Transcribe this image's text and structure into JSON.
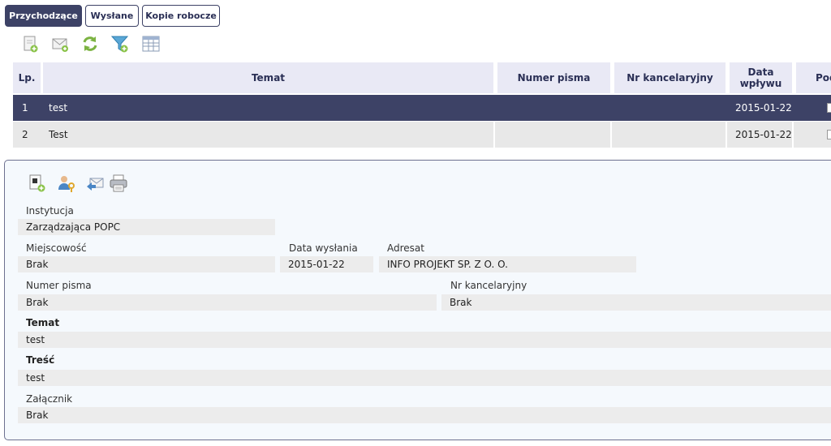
{
  "tabs": [
    {
      "label": "Przychodzące",
      "active": true
    },
    {
      "label": "Wysłane",
      "active": false
    },
    {
      "label": "Kopie robocze",
      "active": false
    }
  ],
  "toolbar": {
    "icons": [
      "new-document-icon",
      "mail-icon",
      "refresh-icon",
      "filter-add-icon",
      "table-columns-icon"
    ]
  },
  "table": {
    "headers": {
      "lp": "Lp.",
      "temat": "Temat",
      "numer_pisma": "Numer pisma",
      "nr_kancelaryjny": "Nr kancelaryjny",
      "data_wplywu": "Data wpływu",
      "pod": "Pod"
    },
    "rows": [
      {
        "lp": "1",
        "temat": "test",
        "numer_pisma": "",
        "nr_kancelaryjny": "",
        "data_wplywu": "2015-01-22"
      },
      {
        "lp": "2",
        "temat": "Test",
        "numer_pisma": "",
        "nr_kancelaryjny": "",
        "data_wplywu": "2015-01-22"
      }
    ]
  },
  "detail": {
    "icons": [
      "attach-add-icon",
      "user-key-icon",
      "reply-mail-icon",
      "printer-icon"
    ],
    "instytucja": {
      "label": "Instytucja",
      "value": "Zarządzająca POPC"
    },
    "miejscowosc": {
      "label": "Miejscowość",
      "value": "Brak"
    },
    "data_wyslania": {
      "label": "Data wysłania",
      "value": "2015-01-22"
    },
    "adresat": {
      "label": "Adresat",
      "value": "INFO PROJEKT SP. Z O. O."
    },
    "numer_pisma": {
      "label": "Numer pisma",
      "value": "Brak"
    },
    "nr_kancelaryjny": {
      "label": "Nr kancelaryjny",
      "value": "Brak"
    },
    "temat": {
      "label": "Temat",
      "value": "test"
    },
    "tresc": {
      "label": "Treść",
      "value": "test"
    },
    "zalacznik": {
      "label": "Załącznik",
      "value": "Brak"
    }
  },
  "colors": {
    "accent": "#3d4266",
    "header_bg": "#e9e9f5",
    "panel_bg": "#f5f9fd"
  }
}
